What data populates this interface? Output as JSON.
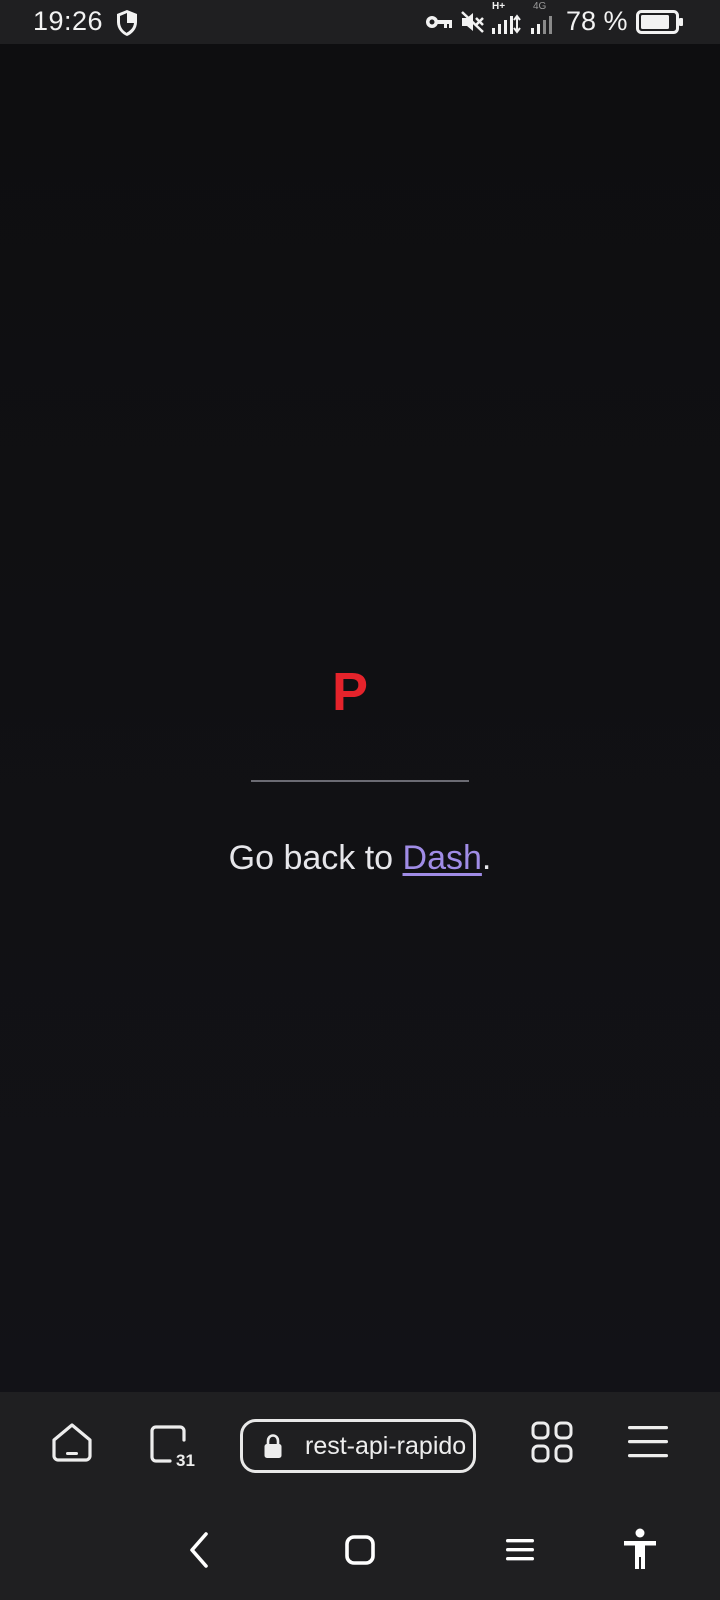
{
  "status_bar": {
    "time": "19:26",
    "battery_percent": "78 %",
    "network_labels": [
      "H+",
      "4G"
    ],
    "icons": [
      "shield-icon",
      "vpn-key-icon",
      "mute-icon",
      "signal-icon",
      "signal-icon",
      "battery-icon"
    ]
  },
  "page": {
    "logo_letter": "P",
    "back_prefix": "Go back to ",
    "back_link": "Dash",
    "back_suffix": "."
  },
  "browser_toolbar": {
    "tabs_count": "31",
    "url": "rest-api-rapido",
    "icons": [
      "home-icon",
      "tabs-icon",
      "lock-icon",
      "grid-icon",
      "menu-icon"
    ]
  },
  "nav_bar": {
    "icons": [
      "back-icon",
      "home-square-icon",
      "recents-icon",
      "accessibility-icon"
    ]
  },
  "colors": {
    "background": "#111114",
    "accent_red": "#e5232b",
    "link_purple": "#a08ce6",
    "bar_bg": "#1f1f21"
  }
}
